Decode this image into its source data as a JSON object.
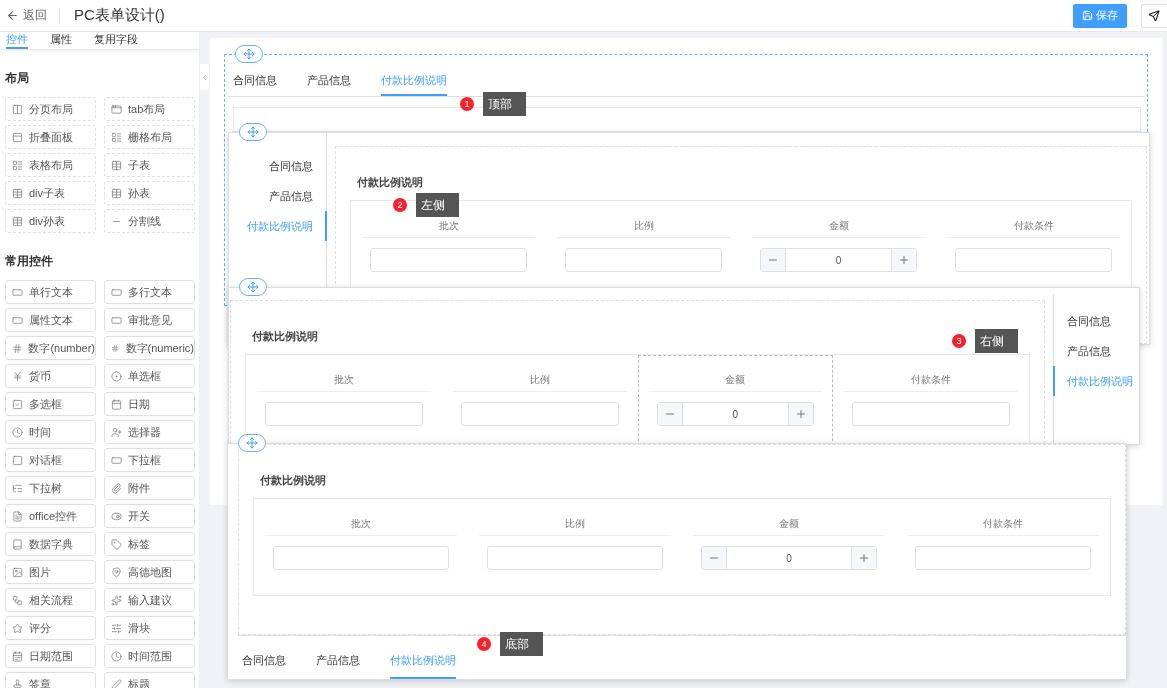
{
  "header": {
    "back_label": "返回",
    "title": "PC表单设计()",
    "save_label": "保存"
  },
  "sidebar": {
    "tabs": [
      {
        "label": "控件",
        "selected": true
      },
      {
        "label": "属性",
        "selected": false
      },
      {
        "label": "复用字段",
        "selected": false
      }
    ],
    "sections": [
      {
        "title": "布局",
        "kind": "layout",
        "items": [
          "分页布局",
          "tab布局",
          "折叠面板",
          "栅格布局",
          "表格布局",
          "子表",
          "div子表",
          "孙表",
          "div孙表",
          "分割线"
        ]
      },
      {
        "title": "常用控件",
        "kind": "control",
        "items": [
          "单行文本",
          "多行文本",
          "属性文本",
          "审批意见",
          "数字(number)",
          "数字(numeric)",
          "货币",
          "单选框",
          "多选框",
          "日期",
          "时间",
          "选择器",
          "对话框",
          "下拉框",
          "下拉树",
          "附件",
          "office控件",
          "开关",
          "数据字典",
          "标签",
          "图片",
          "高德地图",
          "相关流程",
          "输入建议",
          "评分",
          "滑块",
          "日期范围",
          "时间范围",
          "签章",
          "标题"
        ]
      }
    ]
  },
  "layouts": [
    {
      "kind": "top",
      "marker": "1",
      "caption": "顶部",
      "tabs": [
        {
          "label": "合同信息",
          "selected": false
        },
        {
          "label": "产品信息",
          "selected": false
        },
        {
          "label": "付款比例说明",
          "selected": true
        }
      ]
    },
    {
      "kind": "left",
      "marker": "2",
      "caption": "左侧",
      "tabs": [
        {
          "label": "合同信息",
          "selected": false
        },
        {
          "label": "产品信息",
          "selected": false
        },
        {
          "label": "付款比例说明",
          "selected": true
        }
      ],
      "section": {
        "title": "付款比例说明",
        "columns": [
          {
            "label": "批次",
            "selected": false
          },
          {
            "label": "比例",
            "selected": false
          },
          {
            "label": "金额",
            "selected": false
          },
          {
            "label": "付款条件",
            "selected": false
          }
        ],
        "amount": "0"
      }
    },
    {
      "kind": "right",
      "marker": "3",
      "caption": "右侧",
      "tabs": [
        {
          "label": "合同信息",
          "selected": false
        },
        {
          "label": "产品信息",
          "selected": false
        },
        {
          "label": "付款比例说明",
          "selected": true
        }
      ],
      "section": {
        "title": "付款比例说明",
        "columns": [
          {
            "label": "批次",
            "selected": false
          },
          {
            "label": "比例",
            "selected": false
          },
          {
            "label": "金额",
            "selected": true
          },
          {
            "label": "付款条件",
            "selected": false
          }
        ],
        "amount": "0"
      }
    },
    {
      "kind": "bottom",
      "marker": "4",
      "caption": "底部",
      "tabs": [
        {
          "label": "合同信息",
          "selected": false
        },
        {
          "label": "产品信息",
          "selected": false
        },
        {
          "label": "付款比例说明",
          "selected": true
        }
      ],
      "section": {
        "title": "付款比例说明",
        "columns": [
          {
            "label": "批次",
            "selected": false
          },
          {
            "label": "比例",
            "selected": false
          },
          {
            "label": "金额",
            "selected": false
          },
          {
            "label": "付款条件",
            "selected": false
          }
        ],
        "amount": "0"
      }
    }
  ]
}
